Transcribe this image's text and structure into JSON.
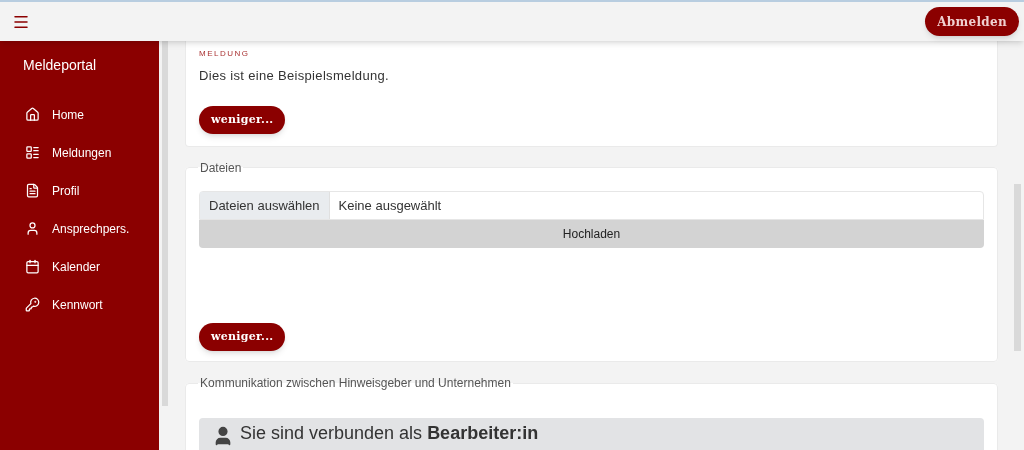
{
  "topbar": {
    "logout_button": "Abmelden"
  },
  "sidebar": {
    "title": "Meldeportal",
    "items": [
      {
        "label": "Home"
      },
      {
        "label": "Meldungen"
      },
      {
        "label": "Profil"
      },
      {
        "label": "Ansprechpers."
      },
      {
        "label": "Kalender"
      },
      {
        "label": "Kennwort"
      }
    ]
  },
  "report": {
    "label": "MELDUNG",
    "text": "Dies ist eine Beispielsmeldung.",
    "less_button": "weniger..."
  },
  "files": {
    "legend": "Dateien",
    "choose_button": "Dateien auswählen",
    "file_status": "Keine ausgewählt",
    "upload_button": "Hochladen",
    "less_button": "weniger..."
  },
  "communication": {
    "legend": "Kommunikation zwischen Hinweisgeber und Unternehmen",
    "connected_text": "Sie sind verbunden als **Bearbeiter:in**"
  }
}
